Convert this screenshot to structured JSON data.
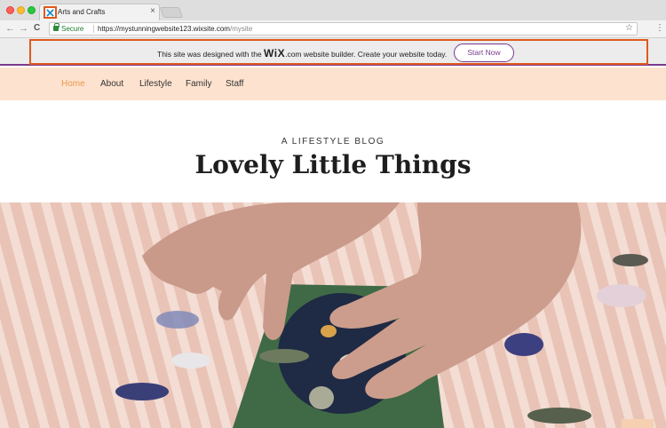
{
  "browser": {
    "tab_title": "Arts and Crafts",
    "tab_close": "×",
    "secure_label": "Secure",
    "url_host": "https://mystunningwebsite123.wixsite.com",
    "url_path": "/mysite",
    "back": "←",
    "forward": "→",
    "reload": "C",
    "star": "☆",
    "menu": "⋮"
  },
  "wix_banner": {
    "text_before": "This site was designed with the ",
    "logo": "WiX",
    "text_after": ".com website builder. Create your website today.",
    "button_label": "Start Now",
    "accent": "#7a3a8c"
  },
  "site_nav": {
    "items": [
      {
        "label": "Home",
        "active": true
      },
      {
        "label": "About",
        "active": false
      },
      {
        "label": "Lifestyle",
        "active": false
      },
      {
        "label": "Family",
        "active": false
      },
      {
        "label": "Staff",
        "active": false
      }
    ],
    "background": "#fde3cf",
    "active_color": "#e8974d"
  },
  "hero": {
    "kicker": "A LIFESTYLE BLOG",
    "title": "Lovely Little Things"
  },
  "highlight_color": "#e0591b"
}
